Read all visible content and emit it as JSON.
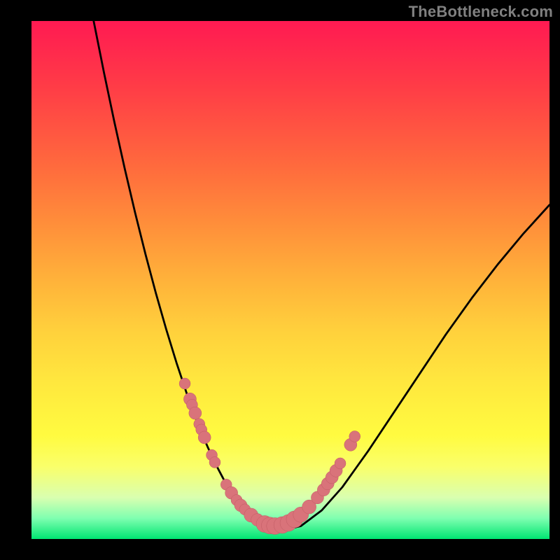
{
  "watermark": "TheBottleneck.com",
  "colors": {
    "frame": "#000000",
    "curve": "#000000",
    "dot_fill": "#d9737a",
    "dot_stroke": "#c05a62",
    "gradient_stops": [
      "#ff1a52",
      "#ff3a47",
      "#ff6a3d",
      "#ff913a",
      "#ffb23a",
      "#ffd13c",
      "#ffe83e",
      "#fffb40",
      "#faff6a",
      "#d9ffb0",
      "#7fffb0",
      "#00e572"
    ]
  },
  "chart_data": {
    "type": "line",
    "title": "",
    "xlabel": "",
    "ylabel": "",
    "xlim": [
      0,
      100
    ],
    "ylim": [
      0,
      100
    ],
    "series": [
      {
        "name": "curve",
        "x": [
          12,
          14,
          16,
          18,
          20,
          22,
          24,
          26,
          28,
          30,
          31,
          32,
          33,
          34,
          35,
          36,
          37,
          38,
          39,
          40,
          42,
          45,
          48,
          52,
          56,
          60,
          65,
          70,
          75,
          80,
          85,
          90,
          95,
          100
        ],
        "y": [
          100,
          90,
          80.5,
          71.5,
          63,
          55,
          47.5,
          40.5,
          34,
          28,
          25.2,
          22.6,
          20.1,
          17.8,
          15.6,
          13.6,
          11.7,
          10,
          8.5,
          7,
          4.8,
          2.5,
          1.6,
          2.5,
          5.5,
          10,
          17,
          24.5,
          32,
          39.5,
          46.5,
          53,
          59,
          64.5
        ]
      }
    ],
    "dots": {
      "name": "highlight",
      "x": [
        29.6,
        30.6,
        31,
        31.6,
        32.4,
        32.8,
        33.4,
        34.8,
        35.4,
        37.6,
        38.6,
        39.6,
        40.4,
        41.2,
        42.4,
        43.6,
        45.0,
        46.0,
        47.0,
        48.4,
        49.6,
        50.8,
        52.0,
        53.6,
        55.2,
        56.4,
        57.2,
        58.0,
        58.8,
        59.6,
        61.6,
        62.4
      ],
      "y": [
        30.0,
        27.0,
        25.9,
        24.3,
        22.2,
        21.1,
        19.6,
        16.2,
        14.8,
        10.5,
        8.9,
        7.5,
        6.5,
        5.7,
        4.6,
        3.7,
        2.9,
        2.6,
        2.5,
        2.7,
        3.1,
        3.8,
        4.7,
        6.2,
        8.0,
        9.5,
        10.7,
        11.9,
        13.2,
        14.6,
        18.2,
        19.8
      ],
      "r": [
        8,
        9,
        8,
        9,
        8,
        8,
        9,
        8,
        8,
        8,
        9,
        8,
        9,
        8,
        10,
        9,
        12,
        12,
        12,
        12,
        12,
        12,
        11,
        10,
        9,
        9,
        9,
        9,
        9,
        8,
        9,
        8
      ]
    }
  }
}
